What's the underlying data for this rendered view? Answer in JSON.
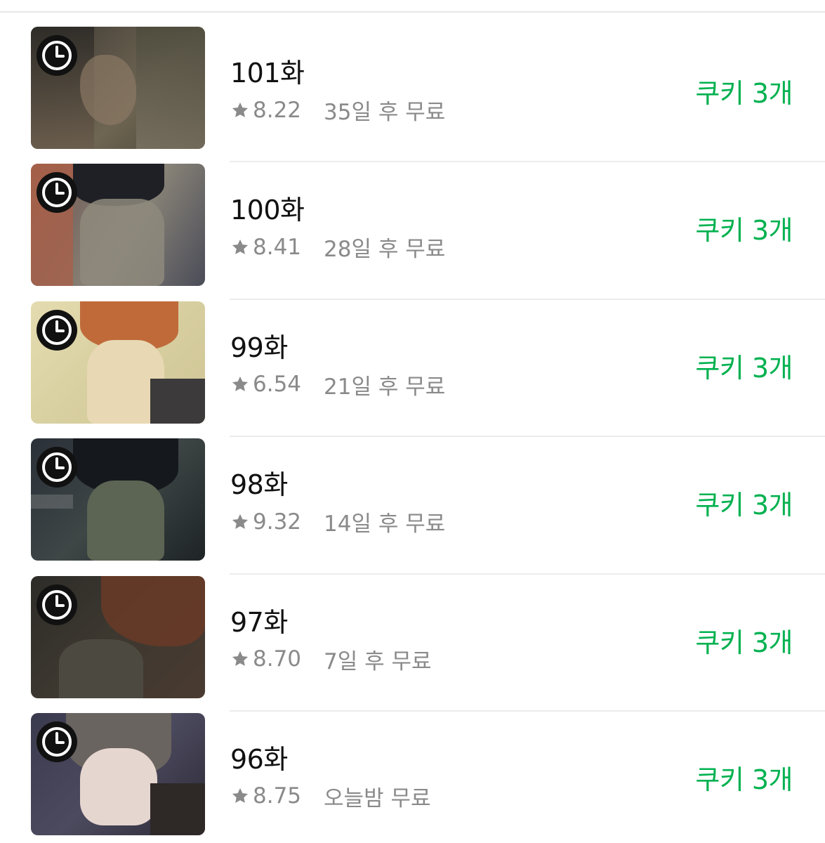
{
  "colors": {
    "price_green": "#00b14f",
    "title_text": "#111111",
    "meta_text": "#8a8a8a",
    "divider": "#ececec"
  },
  "episodes": [
    {
      "title": "101화",
      "rating": "8.22",
      "free_info": "35일 후 무료",
      "price": "쿠키 3개",
      "icon": "clock-icon"
    },
    {
      "title": "100화",
      "rating": "8.41",
      "free_info": "28일 후 무료",
      "price": "쿠키 3개",
      "icon": "clock-icon"
    },
    {
      "title": "99화",
      "rating": "6.54",
      "free_info": "21일 후 무료",
      "price": "쿠키 3개",
      "icon": "clock-icon"
    },
    {
      "title": "98화",
      "rating": "9.32",
      "free_info": "14일 후 무료",
      "price": "쿠키 3개",
      "icon": "clock-icon"
    },
    {
      "title": "97화",
      "rating": "8.70",
      "free_info": "7일 후 무료",
      "price": "쿠키 3개",
      "icon": "clock-icon"
    },
    {
      "title": "96화",
      "rating": "8.75",
      "free_info": "오늘밤 무료",
      "price": "쿠키 3개",
      "icon": "clock-icon"
    }
  ]
}
